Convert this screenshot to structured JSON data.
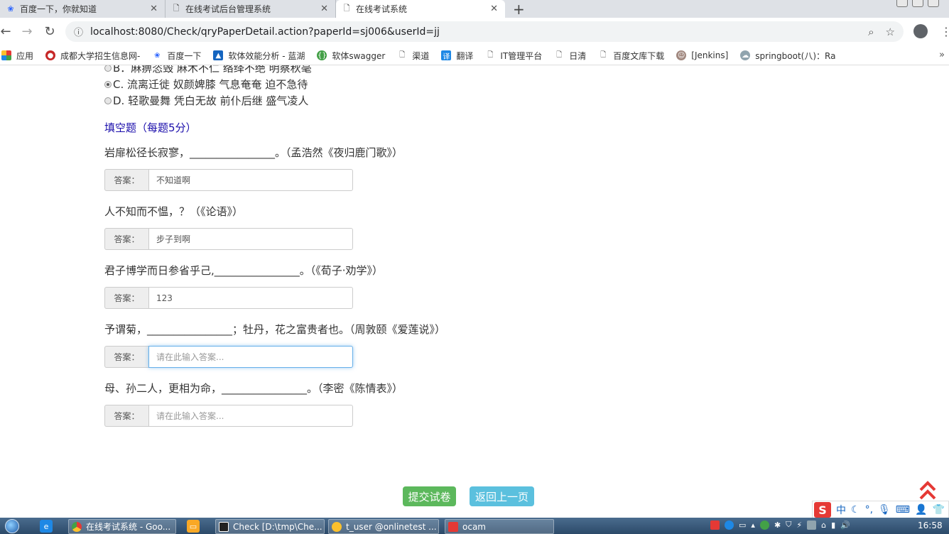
{
  "tabs": [
    {
      "title": "百度一下，你就知道",
      "icon": "paw-icon"
    },
    {
      "title": "在线考试后台管理系统",
      "icon": "page-icon"
    },
    {
      "title": "在线考试系统",
      "icon": "page-icon",
      "active": true
    }
  ],
  "new_tab_label": "+",
  "address": {
    "url": "localhost:8080/Check/qryPaperDetail.action?paperId=sj006&userId=jj"
  },
  "bookmarks": [
    {
      "label": "应用",
      "icon": "apps-grid-icon",
      "color": "#e53935"
    },
    {
      "label": "成都大学招生信息网-",
      "icon": "university-icon",
      "color": "#c62828"
    },
    {
      "label": "百度一下",
      "icon": "paw-icon",
      "color": "#2962ff"
    },
    {
      "label": "软体效能分析 - 蓝湖",
      "icon": "lanhu-icon",
      "color": "#1565c0"
    },
    {
      "label": "软体swagger",
      "icon": "swagger-icon",
      "color": "#43a047"
    },
    {
      "label": "渠道",
      "icon": "page-icon",
      "color": "#ffffff"
    },
    {
      "label": "翻译",
      "icon": "translate-icon",
      "color": "#1e88e5"
    },
    {
      "label": "IT管理平台",
      "icon": "page-icon",
      "color": "#ffffff"
    },
    {
      "label": "日清",
      "icon": "page-icon",
      "color": "#ffffff"
    },
    {
      "label": "百度文库下载",
      "icon": "page-icon",
      "color": "#ffffff"
    },
    {
      "label": "[Jenkins]",
      "icon": "jenkins-icon",
      "color": "#a1887f"
    },
    {
      "label": "springboot(八)：Ra",
      "icon": "cloud-icon",
      "color": "#90a4ae"
    }
  ],
  "exam": {
    "options": [
      {
        "text": "B．麻痹恣毁 麻木不仁 络绎不绝 明察秋毫",
        "selected": false
      },
      {
        "text": "C. 流离迁徙 奴颜婢膝 气息奄奄 迫不急待",
        "selected": true
      },
      {
        "text": "D. 轻歌曼舞 凭白无故 前仆后继 盛气凌人",
        "selected": false
      }
    ],
    "section_title": "填空题（每题5分）",
    "answer_label": "答案：",
    "placeholder": "请在此输入答案...",
    "questions": [
      {
        "text": "岩扉松径长寂寥，________________。（孟浩然《夜归鹿门歌》）",
        "answer": "不知道啊"
      },
      {
        "text": "人不知而不愠，？（《论语》）",
        "answer": "步子到啊"
      },
      {
        "text": "君子博学而日参省乎己,________________。（《荀子·劝学》）",
        "answer": "123"
      },
      {
        "text": "予谓菊，________________；牡丹，花之富贵者也。（周敦颐《爱莲说》）",
        "answer": ""
      },
      {
        "text": "母、孙二人，更相为命，________________。（李密《陈情表》）",
        "answer": ""
      }
    ],
    "submit_label": "提交试卷",
    "back_label": "返回上一页"
  },
  "ime": {
    "mode": "中"
  },
  "taskbar": {
    "tasks": [
      {
        "label": "在线考试系统 - Goo...",
        "icon": "chrome-icon"
      },
      {
        "label": "Check [D:\\tmp\\Che...",
        "icon": "intellij-icon"
      },
      {
        "label": "t_user @onlinetest ...",
        "icon": "navicat-icon"
      },
      {
        "label": "ocam",
        "icon": "ocam-icon"
      }
    ],
    "clock": "16:58"
  },
  "colors": {
    "submit": "#5cb85c",
    "back": "#5bc0de",
    "section_title": "#1a0dab",
    "to_top": "#e53935"
  }
}
